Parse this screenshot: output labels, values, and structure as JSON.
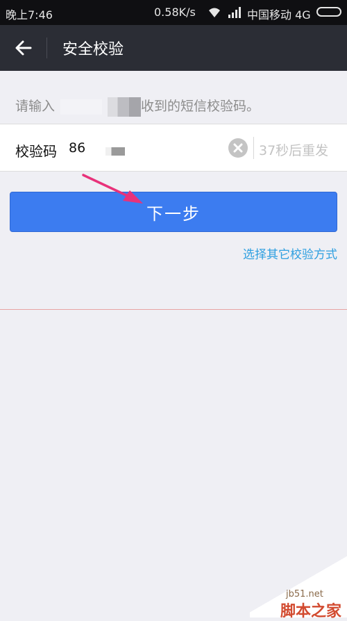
{
  "status_bar": {
    "time": "晚上7:46",
    "network_speed": "0.58K/s",
    "carrier": "中国移动 4G"
  },
  "app_bar": {
    "title": "安全校验"
  },
  "hint": {
    "prefix": "请输入",
    "suffix": "收到的短信校验码。"
  },
  "code_field": {
    "label": "校验码",
    "value": "86",
    "countdown": "37秒后重发"
  },
  "next_button": {
    "label": "下一步"
  },
  "other_method_link": "选择其它校验方式",
  "watermark": {
    "domain": "jb51.net",
    "brand": "脚本之家"
  },
  "colors": {
    "app_bar_bg": "#2b2d35",
    "button_bg": "#3c7cf0",
    "link": "#2e9fe0",
    "annotation_arrow": "#e8327a"
  }
}
